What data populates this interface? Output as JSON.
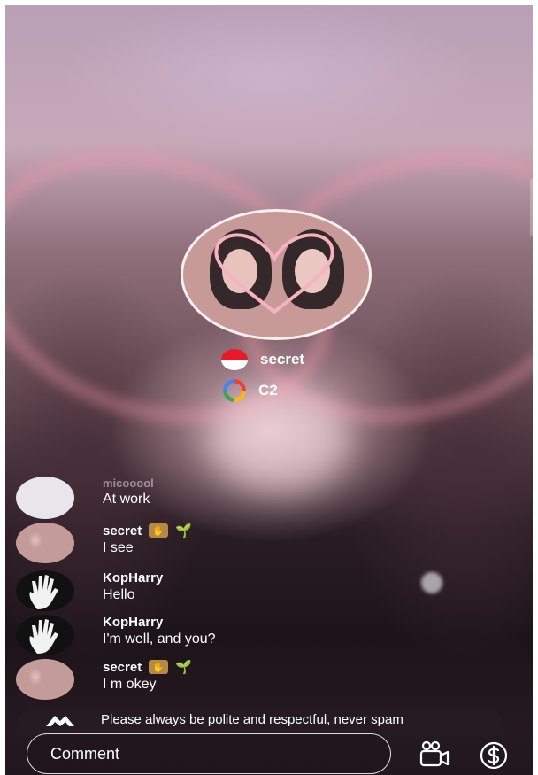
{
  "host": {
    "avatar_icon": "host-avatar",
    "name": "secret",
    "flag_icon": "indonesia-flag-icon",
    "level": "C2",
    "level_icon": "rainbow-ring-icon"
  },
  "chat": {
    "partial_message": {
      "name": "micooool",
      "body": "At work"
    },
    "messages": [
      {
        "name": "secret",
        "body": "I see",
        "avatar": "secret-avatar",
        "badges": [
          "hand-badge-icon",
          "sprout-icon"
        ]
      },
      {
        "name": "KopHarry",
        "body": "Hello",
        "avatar": "hand-print-avatar",
        "badges": []
      },
      {
        "name": "KopHarry",
        "body": "I'm well, and you?",
        "avatar": "hand-print-avatar",
        "badges": []
      },
      {
        "name": "secret",
        "body": "I m okey",
        "avatar": "secret-avatar",
        "badges": [
          "hand-badge-icon",
          "sprout-icon"
        ]
      }
    ]
  },
  "notice": {
    "text": "Please always be polite and respectful, never spam"
  },
  "bottom_bar": {
    "comment_placeholder": "Comment",
    "video_icon": "video-camera-icon",
    "gift_icon": "dollar-coin-icon"
  },
  "colors": {
    "text": "#ffffff",
    "sprout": "#34c36b",
    "badge": "#b58a42",
    "flag_red": "#e9192a"
  }
}
